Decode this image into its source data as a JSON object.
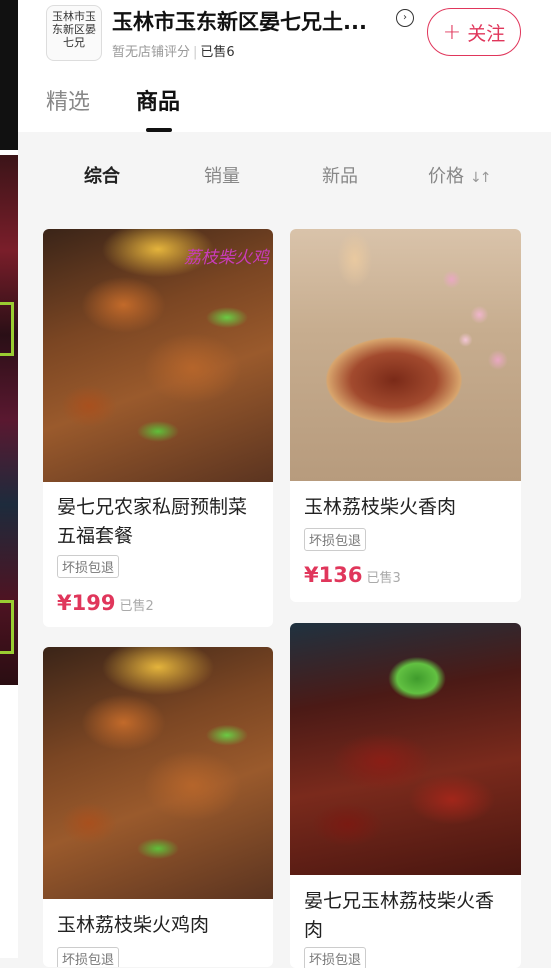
{
  "shop": {
    "logo_text": "玉林市玉东新区晏七兄",
    "name": "玉林市玉东新区晏七兄土...",
    "rating": "暂无店铺评分",
    "sold": "已售6",
    "follow_label": "关注",
    "follow_icon": "plus-icon",
    "info_icon": "chevron-right-circle-icon"
  },
  "tabs": [
    {
      "label": "精选",
      "active": false
    },
    {
      "label": "商品",
      "active": true
    }
  ],
  "sort_options": [
    {
      "label": "综合",
      "active": true
    },
    {
      "label": "销量",
      "active": false
    },
    {
      "label": "新品",
      "active": false
    },
    {
      "label": "价格",
      "active": false,
      "icon": "sort-arrows-icon"
    }
  ],
  "products": [
    {
      "title_line1": "晏七兄农家私厨预制菜",
      "title_line2": "五福套餐",
      "badge": "坏损包退",
      "price": "¥199",
      "sold": "已售2",
      "image_caption": "荔枝柴火鸡"
    },
    {
      "title_line1": "玉林荔枝柴火香肉",
      "title_line2": "",
      "badge": "坏损包退",
      "price": "¥136",
      "sold": "已售3"
    },
    {
      "title_line1": "玉林荔枝柴火鸡肉",
      "title_line2": "",
      "badge": "坏损包退",
      "price": "",
      "sold": ""
    },
    {
      "title_line1": "晏七兄玉林荔枝柴火香",
      "title_line2": "肉",
      "badge": "坏损包退",
      "price": "",
      "sold": ""
    }
  ],
  "colors": {
    "accent": "#e0365b",
    "background": "#f5f5f5",
    "card": "#ffffff"
  }
}
